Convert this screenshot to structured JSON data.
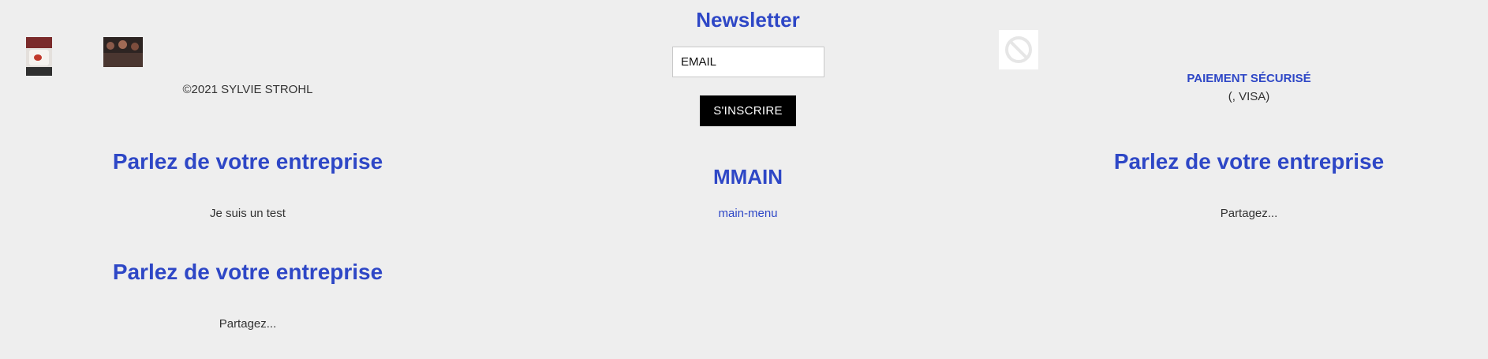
{
  "footer_left": {
    "copyright": "©2021 SYLVIE STROHL",
    "blocks": [
      {
        "heading": "Parlez de votre entreprise",
        "text": "Je suis un test"
      },
      {
        "heading": "Parlez de votre entreprise",
        "text": "Partagez..."
      }
    ]
  },
  "newsletter": {
    "title": "Newsletter",
    "email_value": "EMAIL",
    "subscribe_label": "S'INSCRIRE"
  },
  "menu": {
    "title": "MMAIN",
    "link_label": "main-menu"
  },
  "footer_right": {
    "payment_title": "PAIEMENT SÉCURISÉ",
    "payment_methods": "(, VISA)",
    "block": {
      "heading": "Parlez de votre entreprise",
      "text": "Partagez..."
    }
  },
  "colors": {
    "accent": "#2e47c6",
    "background": "#eeeeee",
    "button": "#000000"
  }
}
